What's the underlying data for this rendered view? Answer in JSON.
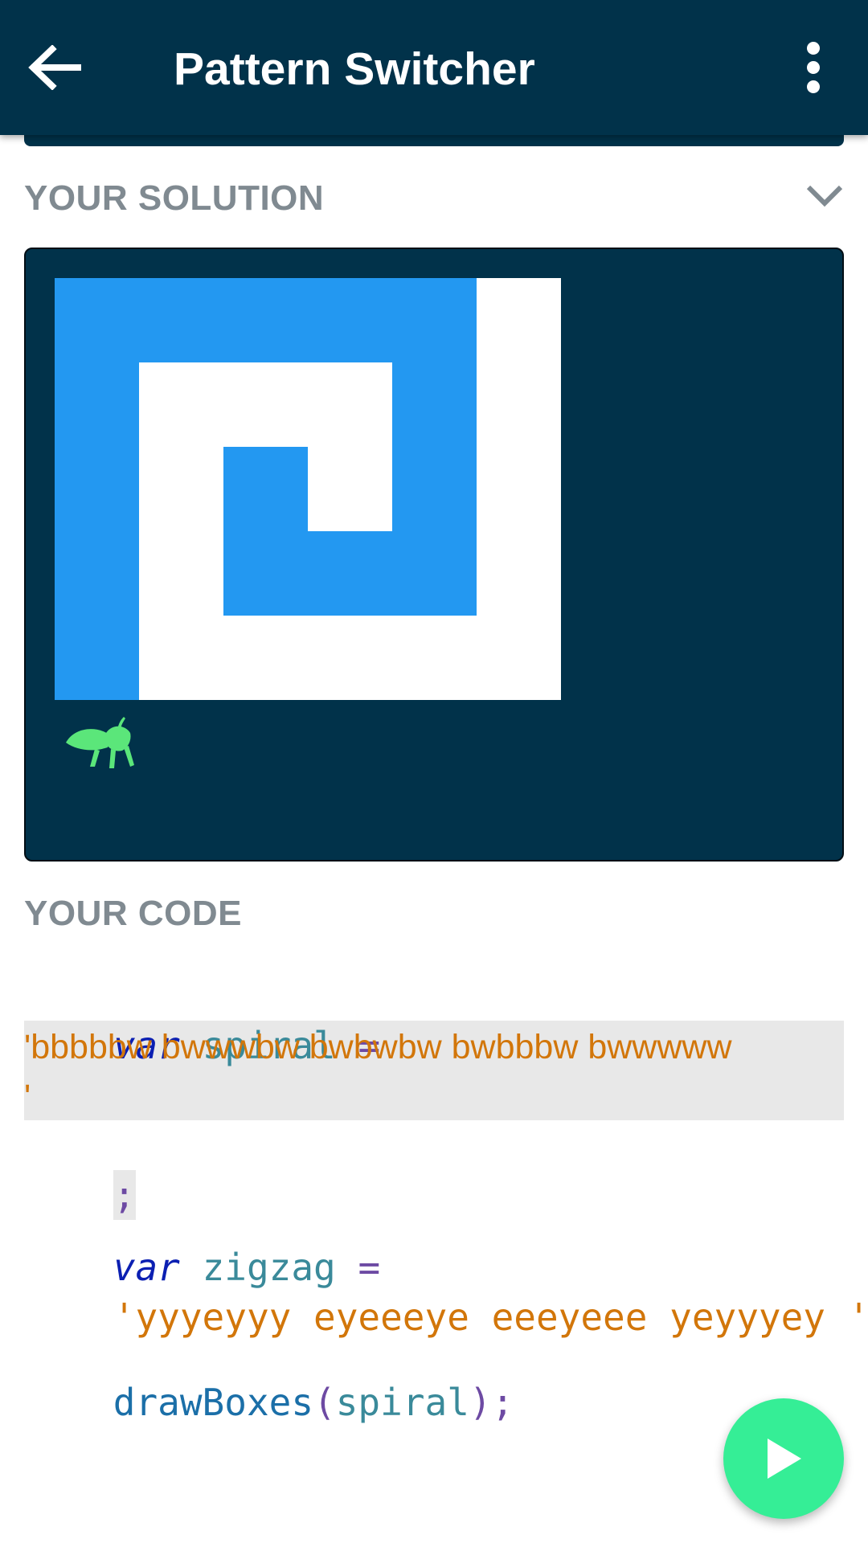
{
  "appbar": {
    "title": "Pattern Switcher",
    "back_icon": "arrow-left-icon",
    "menu_icon": "more-vert-icon"
  },
  "solution": {
    "title": "YOUR SOLUTION",
    "toggle_icon": "chevron-down-icon",
    "grid": {
      "rows": [
        "bbbbbw",
        "bwwwbw",
        "bwbwbw",
        "bwbbbw",
        "bwwwww"
      ],
      "legend": {
        "b": "#2398f1",
        "w": "#ffffff"
      }
    },
    "sprite_icon": "grasshopper-icon"
  },
  "code": {
    "title": "YOUR CODE",
    "line1": {
      "kw": "var",
      "name": "spiral",
      "eq": "="
    },
    "line2": "'bbbbbw bwwwbw bwbwbw bwbbbw bwwwww",
    "line3": "'",
    "line4": ";",
    "line5": {
      "kw": "var",
      "name": "zigzag",
      "eq": "="
    },
    "line6": {
      "str": "'yyyeyyy eyeeeye eeeyeee yeyyyey '",
      "semi": ";"
    },
    "line7": {
      "fn": "drawBoxes",
      "open": "(",
      "arg": "spiral",
      "close": ");"
    }
  },
  "run_button": {
    "icon": "play-icon"
  },
  "colors": {
    "appbar": "#01324a",
    "accent": "#35ee96",
    "blue_box": "#2398f1"
  }
}
